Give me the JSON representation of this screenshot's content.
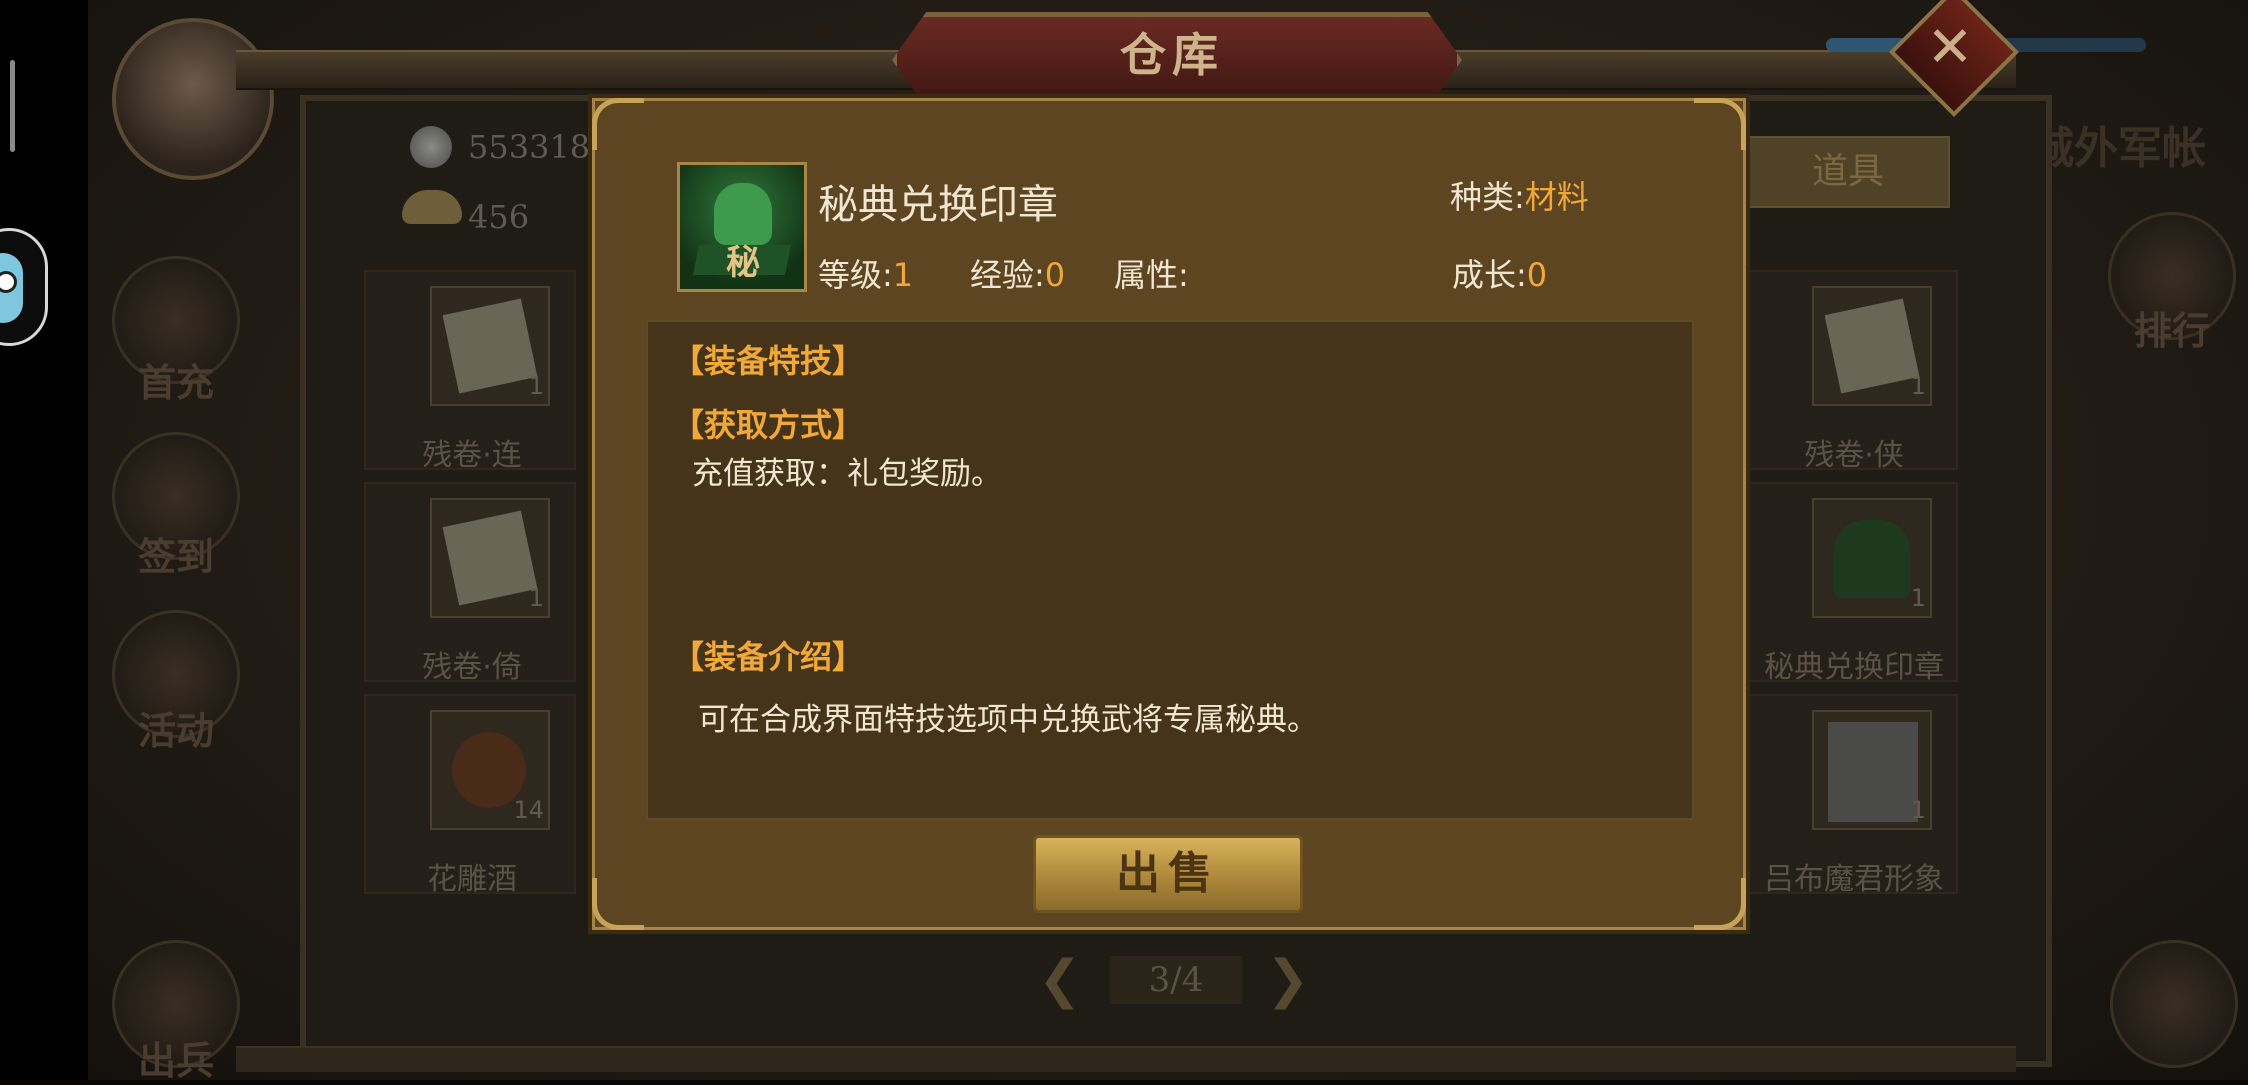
{
  "title": "仓库",
  "close_icon": "close-x-icon",
  "currency": {
    "coins": "553318",
    "ingots": "456"
  },
  "tab": {
    "label": "道具"
  },
  "right_text": "城外军帐",
  "side_menu": [
    {
      "label": "首充"
    },
    {
      "label": "签到"
    },
    {
      "label": "活动"
    },
    {
      "label": "出兵"
    }
  ],
  "right_menu": [
    {
      "label": "排行"
    }
  ],
  "grid": {
    "left": [
      {
        "name": "残卷·连",
        "count": "1"
      },
      {
        "name": "残卷·倚",
        "count": "1"
      },
      {
        "name": "花雕酒",
        "count": "14"
      }
    ],
    "right": [
      {
        "name": "残卷·侠",
        "count": "1"
      },
      {
        "name": "秘典兑换印章",
        "count": "1"
      },
      {
        "name": "吕布魔君形象",
        "count": "1"
      }
    ]
  },
  "pager": {
    "text": "3/4"
  },
  "modal": {
    "item_name": "秘典兑换印章",
    "icon_glyph": "秘",
    "type_label": "种类:",
    "type_value": "材料",
    "level_label": "等级:",
    "level_value": "1",
    "exp_label": "经验:",
    "exp_value": "0",
    "attr_label": "属性:",
    "growth_label": "成长:",
    "growth_value": "0",
    "section_skill": "【装备特技】",
    "section_obtain": "【获取方式】",
    "obtain_text": "充值获取：礼包奖励。",
    "section_intro": "【装备介绍】",
    "intro_text": "可在合成界面特技选项中兑换武将专属秘典。",
    "sell_label": "出售"
  }
}
